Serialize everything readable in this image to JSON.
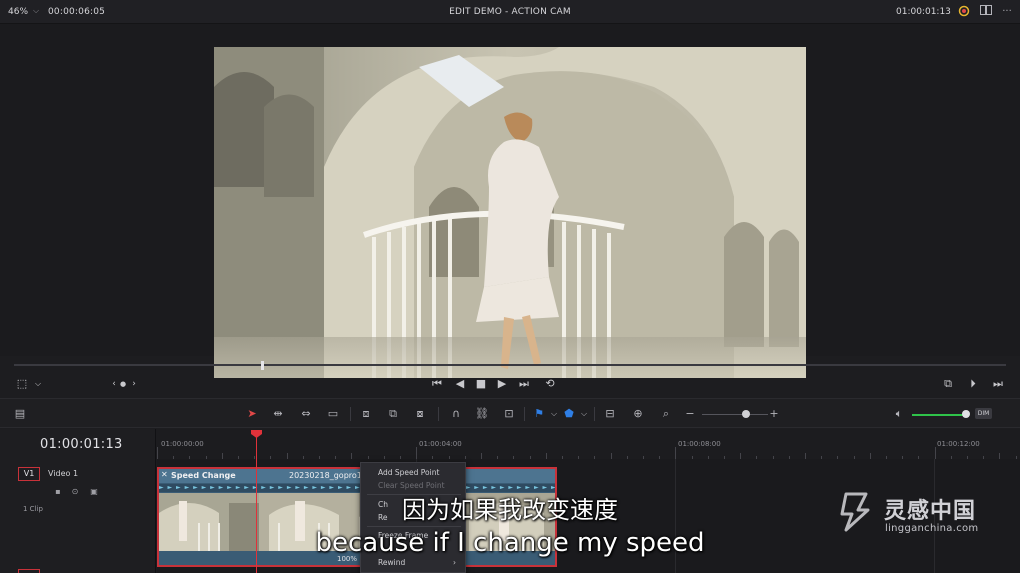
{
  "topbar": {
    "zoom": "46%",
    "timecode_left": "00:00:06:05",
    "title": "EDIT DEMO - ACTION CAM",
    "timecode_right": "01:00:01:13",
    "icons": [
      "color-wheel-icon",
      "dual-view-icon",
      "more-options-icon"
    ]
  },
  "transport": {
    "icons": [
      "crop-icon",
      "prev-marker-icon",
      "next-marker-icon",
      "skip-to-start-icon",
      "play-reverse-icon",
      "stop-icon",
      "play-icon",
      "skip-to-end-icon",
      "loop-icon",
      "match-frame-icon",
      "next-clip-icon",
      "last-frame-icon"
    ]
  },
  "toolbar": {
    "dim_label": "DIM",
    "colors": {
      "volume": "#2fc34a",
      "flag": "#2f7fe6",
      "marker": "#2f7fe6"
    }
  },
  "timeline": {
    "timecode": "01:00:01:13",
    "track_label": "V1",
    "track_name": "Video 1",
    "clip_count": "1 Clip",
    "ruler_labels": [
      "01:00:00:00",
      "01:00:04:00",
      "01:00:08:00",
      "01:00:12:00"
    ],
    "clip": {
      "title": "Speed Change",
      "file": "20230218_gopro11",
      "speed_percent": "100%",
      "speed_strip": "► ► ► ► ► ► ► ► ► ► ► ► ► ► ► ► ► ► ► ► ► ► ► ► ► ► ► ► ► ► ► ► ► ► ► ► ► ► ► ► ► ► ► ► ► ► ► ► ► ► ► ► ► ►"
    },
    "colors": {
      "selection": "#c8323a",
      "clip": "#3a5c75",
      "playhead": "#e0323a"
    }
  },
  "context_menu": {
    "items": [
      {
        "label": "Add Speed Point",
        "enabled": true
      },
      {
        "label": "Clear Speed Point",
        "enabled": false
      },
      {
        "label": "Ch",
        "enabled": true
      },
      {
        "label": "Re",
        "enabled": true
      },
      {
        "label": "Freeze Frame",
        "enabled": true
      },
      {
        "label": "Rewind",
        "enabled": true
      }
    ]
  },
  "subtitles": {
    "chinese": "因为如果我改变速度",
    "english": "because if I change my speed"
  },
  "watermark": {
    "brand": "灵感中国",
    "url": "lingganchina.com"
  }
}
